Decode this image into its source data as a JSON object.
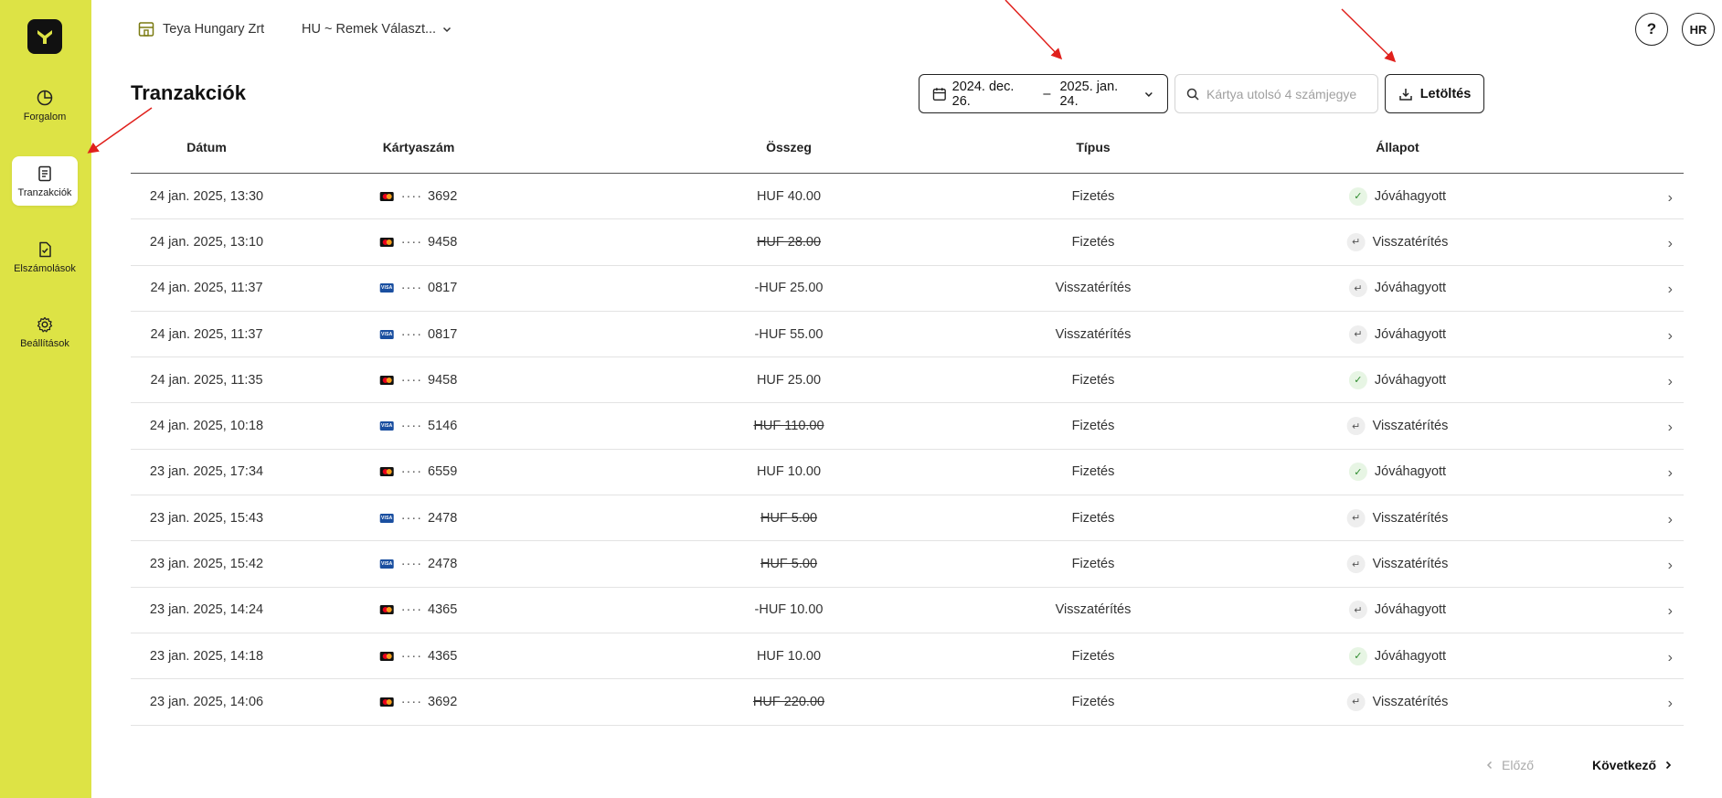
{
  "sidebar": {
    "items": [
      {
        "label": "Forgalom",
        "icon": "pie-chart-icon",
        "active": false
      },
      {
        "label": "Tranzakciók",
        "icon": "receipt-icon",
        "active": true
      },
      {
        "label": "Elszámolások",
        "icon": "document-check-icon",
        "active": false
      },
      {
        "label": "Beállítások",
        "icon": "gear-icon",
        "active": false
      }
    ]
  },
  "header": {
    "org_name": "Teya Hungary Zrt",
    "store_name": "HU ~ Remek Választ...",
    "help_label": "?",
    "avatar_initials": "HR"
  },
  "page": {
    "title": "Tranzakciók"
  },
  "filters": {
    "date_from": "2024. dec. 26.",
    "date_sep": "–",
    "date_to": "2025. jan. 24.",
    "search_placeholder": "Kártya utolsó 4 számjegye",
    "download_label": "Letöltés"
  },
  "table": {
    "columns": [
      "Dátum",
      "Kártyaszám",
      "Összeg",
      "Típus",
      "Állapot"
    ],
    "rows": [
      {
        "date": "24 jan. 2025, 13:30",
        "brand": "mastercard",
        "card": "3692",
        "amount": "HUF 40.00",
        "struck": false,
        "type": "Fizetés",
        "status": "Jóváhagyott",
        "status_kind": "ok"
      },
      {
        "date": "24 jan. 2025, 13:10",
        "brand": "mastercard",
        "card": "9458",
        "amount": "HUF 28.00",
        "struck": true,
        "type": "Fizetés",
        "status": "Visszatérítés",
        "status_kind": "refund"
      },
      {
        "date": "24 jan. 2025, 11:37",
        "brand": "visa",
        "card": "0817",
        "amount": "-HUF 25.00",
        "struck": false,
        "type": "Visszatérítés",
        "status": "Jóváhagyott",
        "status_kind": "refund"
      },
      {
        "date": "24 jan. 2025, 11:37",
        "brand": "visa",
        "card": "0817",
        "amount": "-HUF 55.00",
        "struck": false,
        "type": "Visszatérítés",
        "status": "Jóváhagyott",
        "status_kind": "refund"
      },
      {
        "date": "24 jan. 2025, 11:35",
        "brand": "mastercard",
        "card": "9458",
        "amount": "HUF 25.00",
        "struck": false,
        "type": "Fizetés",
        "status": "Jóváhagyott",
        "status_kind": "ok"
      },
      {
        "date": "24 jan. 2025, 10:18",
        "brand": "visa",
        "card": "5146",
        "amount": "HUF 110.00",
        "struck": true,
        "type": "Fizetés",
        "status": "Visszatérítés",
        "status_kind": "refund"
      },
      {
        "date": "23 jan. 2025, 17:34",
        "brand": "mastercard",
        "card": "6559",
        "amount": "HUF 10.00",
        "struck": false,
        "type": "Fizetés",
        "status": "Jóváhagyott",
        "status_kind": "ok"
      },
      {
        "date": "23 jan. 2025, 15:43",
        "brand": "visa",
        "card": "2478",
        "amount": "HUF 5.00",
        "struck": true,
        "type": "Fizetés",
        "status": "Visszatérítés",
        "status_kind": "refund"
      },
      {
        "date": "23 jan. 2025, 15:42",
        "brand": "visa",
        "card": "2478",
        "amount": "HUF 5.00",
        "struck": true,
        "type": "Fizetés",
        "status": "Visszatérítés",
        "status_kind": "refund"
      },
      {
        "date": "23 jan. 2025, 14:24",
        "brand": "mastercard",
        "card": "4365",
        "amount": "-HUF 10.00",
        "struck": false,
        "type": "Visszatérítés",
        "status": "Jóváhagyott",
        "status_kind": "refund"
      },
      {
        "date": "23 jan. 2025, 14:18",
        "brand": "mastercard",
        "card": "4365",
        "amount": "HUF 10.00",
        "struck": false,
        "type": "Fizetés",
        "status": "Jóváhagyott",
        "status_kind": "ok"
      },
      {
        "date": "23 jan. 2025, 14:06",
        "brand": "mastercard",
        "card": "3692",
        "amount": "HUF 220.00",
        "struck": true,
        "type": "Fizetés",
        "status": "Visszatérítés",
        "status_kind": "refund"
      }
    ],
    "card_mask": "····",
    "visa_text": "VISA"
  },
  "pagination": {
    "prev_label": "Előző",
    "next_label": "Következő"
  },
  "colors": {
    "sidebar_bg": "#dde345",
    "annotation_arrow": "#e0201c"
  }
}
